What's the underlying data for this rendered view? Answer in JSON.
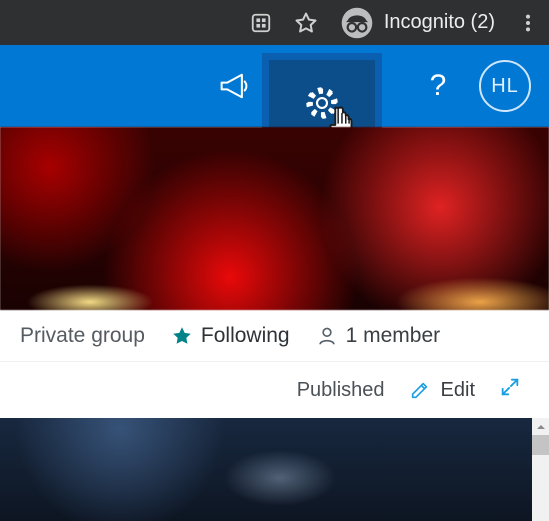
{
  "browser": {
    "mode_label": "Incognito (2)"
  },
  "header": {
    "avatar_initials": "HL"
  },
  "info": {
    "privacy": "Private group",
    "follow_label": "Following",
    "member_count": "1 member"
  },
  "actions": {
    "status": "Published",
    "edit_label": "Edit"
  },
  "colors": {
    "sp_blue": "#0078d4",
    "highlight_border": "#0a5fb0",
    "follow_star": "#038387",
    "edit_pencil": "#0086d4"
  }
}
